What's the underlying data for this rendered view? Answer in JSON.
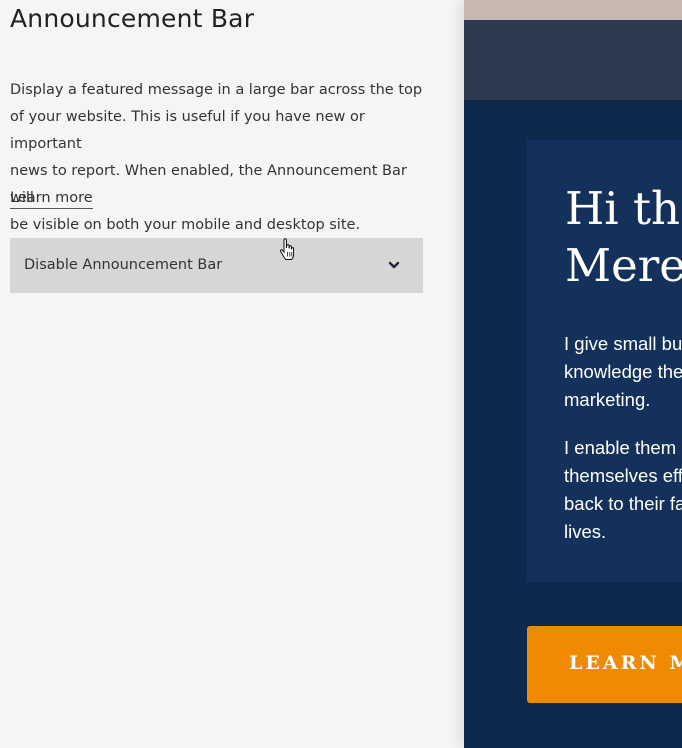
{
  "panel": {
    "title": "Announcement Bar",
    "description_lines": [
      "Display a featured message in a large bar across the top",
      "of your website. This is useful if you have new or important",
      "news to report. When enabled, the Announcement Bar will",
      "be visible on both your mobile and desktop site."
    ],
    "learn_more": "Learn more",
    "select": {
      "value": "Disable Announcement Bar",
      "icon": "chevron-down-icon"
    }
  },
  "preview": {
    "hero_title_lines": [
      "Hi the",
      "Mere"
    ],
    "paragraph1_lines": [
      "I give small bu",
      "knowledge the",
      "marketing."
    ],
    "paragraph2_lines": [
      "I enable them",
      "themselves eff",
      "back to their fa",
      "lives."
    ],
    "cta_label": "LEARN MO",
    "colors": {
      "background": "#0c2a4e",
      "card": "#14315c",
      "header": "#2c3b4f",
      "cta": "#f08a00"
    }
  }
}
